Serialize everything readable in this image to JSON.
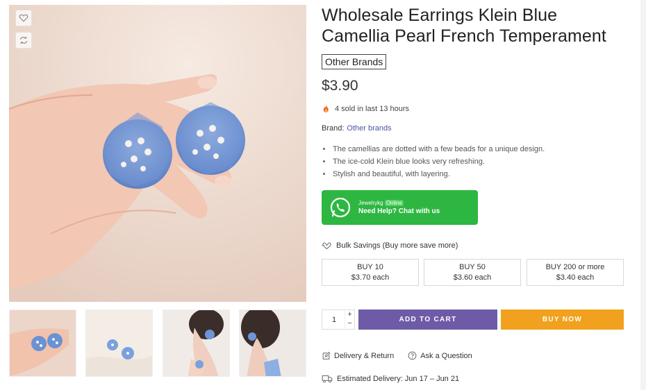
{
  "product": {
    "title": "Wholesale Earrings Klein Blue Camellia Pearl French Temperament",
    "brand_badge": "Other Brands",
    "price": "$3.90",
    "sold_text": "4 sold in last 13 hours",
    "brand_label": "Brand:",
    "brand_value": "Other brands",
    "features": [
      "The camellias are dotted with a few beads for a unique design.",
      "The ice-cold Klein blue looks very refreshing.",
      "Stylish and beautiful, with layering."
    ]
  },
  "whatsapp": {
    "name": "Jewelrykg",
    "status": "Online",
    "cta": "Need Help? Chat with us"
  },
  "bulk": {
    "heading": "Bulk Savings (Buy more save more)",
    "tiers": [
      {
        "qty": "BUY 10",
        "price": "$3.70 each"
      },
      {
        "qty": "BUY 50",
        "price": "$3.60 each"
      },
      {
        "qty": "BUY 200 or more",
        "price": "$3.40 each"
      }
    ]
  },
  "cart": {
    "quantity": "1",
    "plus": "+",
    "minus": "−",
    "add_to_cart": "ADD TO CART",
    "buy_now": "BUY NOW"
  },
  "links": {
    "delivery_return": "Delivery & Return",
    "ask_question": "Ask a Question",
    "estimated_delivery": "Estimated Delivery: Jun 17 – Jun 21"
  },
  "colors": {
    "whatsapp_green": "#2db742",
    "add_to_cart": "#6d5ba7",
    "buy_now": "#f1a11e",
    "brand_link": "#4a55a2"
  },
  "icons": {
    "wishlist": "heart-icon",
    "compare": "refresh-icon",
    "sold": "fire-icon",
    "bulk": "gift-icon",
    "delivery_return": "edit-icon",
    "ask": "question-icon",
    "estimated_delivery": "truck-icon"
  }
}
